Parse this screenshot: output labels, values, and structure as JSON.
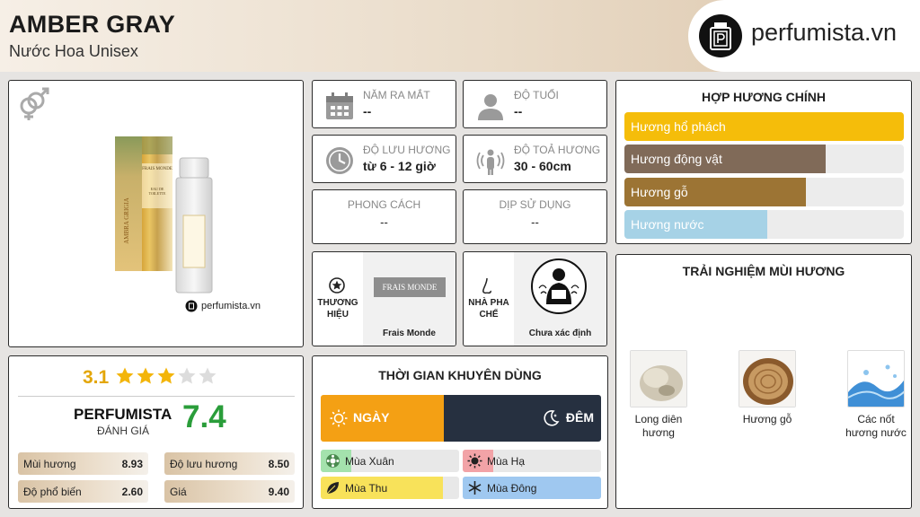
{
  "header": {
    "title": "AMBER GRAY",
    "subtitle": "Nước Hoa Unisex",
    "logo_text": "perfumista.vn"
  },
  "product": {
    "brand_on_box": "FRAIS MONDE",
    "box_text": "EAU DE TOILETTE",
    "box_side_text": "AMBRA GRIGIA",
    "watermark": "perfumista.vn"
  },
  "info": {
    "release_year": {
      "label": "NĂM RA MẮT",
      "value": "--"
    },
    "age": {
      "label": "ĐỘ TUỔI",
      "value": "--"
    },
    "longevity": {
      "label": "ĐỘ LƯU HƯƠNG",
      "value": "từ 6 - 12 giờ"
    },
    "sillage": {
      "label": "ĐỘ TOẢ HƯƠNG",
      "value": "30 - 60cm"
    },
    "style": {
      "label": "PHONG CÁCH",
      "value": "--"
    },
    "occasion": {
      "label": "DỊP SỬ DỤNG",
      "value": "--"
    }
  },
  "brand": {
    "label_line1": "THƯƠNG",
    "label_line2": "HIỆU",
    "logo_text": "FRAIS MONDE",
    "name": "Frais Monde"
  },
  "perfumer": {
    "label_line1": "NHÀ PHA",
    "label_line2": "CHẾ",
    "name": "Chưa xác định"
  },
  "accords": {
    "title": "HỢP HƯƠNG CHÍNH",
    "items": [
      {
        "name": "Hương hổ phách",
        "level": 1.0,
        "color": "#f5bd0a"
      },
      {
        "name": "Hương động vật",
        "level": 0.72,
        "color": "#806a58"
      },
      {
        "name": "Hương gỗ",
        "level": 0.65,
        "color": "#9c7434"
      },
      {
        "name": "Hương nước",
        "level": 0.51,
        "color": "#a6d2e6"
      }
    ]
  },
  "rating": {
    "score": "3.1",
    "stars_filled": 3,
    "stars_total": 5,
    "pf_name": "PERFUMISTA",
    "pf_sub": "ĐÁNH GIÁ",
    "pf_score": "7.4",
    "stats": [
      {
        "label": "Mùi hương",
        "value": "8.93"
      },
      {
        "label": "Độ lưu hương",
        "value": "8.50"
      },
      {
        "label": "Độ phổ biến",
        "value": "2.60"
      },
      {
        "label": "Giá",
        "value": "9.40"
      }
    ]
  },
  "time": {
    "title": "THỜI GIAN KHUYÊN DÙNG",
    "day": "NGÀY",
    "night": "ĐÊM",
    "day_share": 0.44,
    "seasons": [
      {
        "name": "Mùa Xuân",
        "level": 0.22,
        "color": "#a4e2ad"
      },
      {
        "name": "Mùa Hạ",
        "level": 0.22,
        "color": "#f2a3a7"
      },
      {
        "name": "Mùa Thu",
        "level": 0.88,
        "color": "#f8e25a"
      },
      {
        "name": "Mùa Đông",
        "level": 1.0,
        "color": "#9fc8f0"
      }
    ]
  },
  "experience": {
    "title": "TRẢI NGHIỆM MÙI HƯƠNG",
    "items": [
      {
        "line1": "Long diên",
        "line2": "hương"
      },
      {
        "line1": "Hương gỗ",
        "line2": ""
      },
      {
        "line1": "Các nốt",
        "line2": "hương nước"
      }
    ]
  }
}
